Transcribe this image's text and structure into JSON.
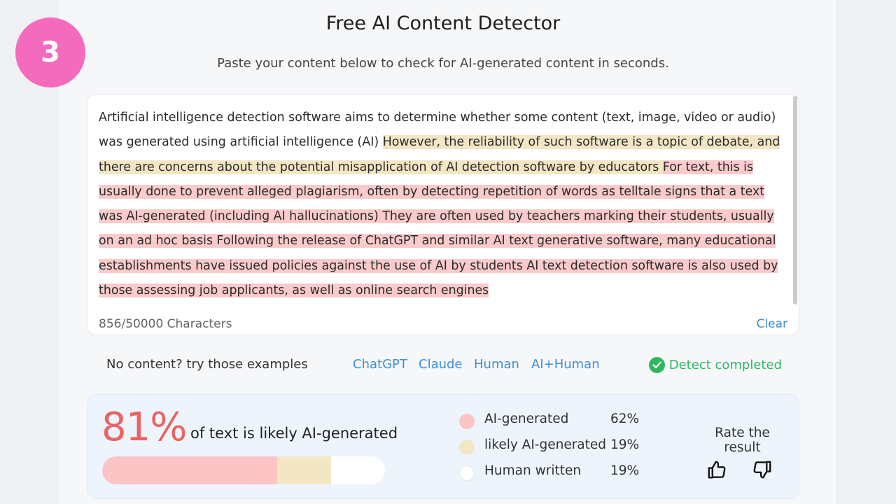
{
  "step_badge": "3",
  "header": {
    "title": "Free AI Content Detector",
    "subtitle": "Paste your content below to check for AI-generated content in seconds."
  },
  "editor": {
    "segments": [
      {
        "type": "human",
        "text": "Artificial intelligence detection software aims to determine whether some content (text, image, video or audio) was generated using artificial intelligence (AI) "
      },
      {
        "type": "likely",
        "text": "However, the reliability of such software is a topic of debate, and there are concerns about the potential misapplication of AI detection software by educators "
      },
      {
        "type": "ai",
        "text": "For text, this is usually done to prevent alleged plagiarism, often by detecting repetition of words as telltale signs that a text was AI-generated (including AI hallucinations) They are often used by teachers marking their students, usually on an ad hoc basis Following the release of ChatGPT and similar AI text generative software, many educational establishments have issued policies against the use of AI by students AI text detection software is also used by those assessing job applicants, as well as online search engines"
      }
    ],
    "char_count": "856/50000 Characters",
    "clear_label": "Clear"
  },
  "examples": {
    "label": "No content? try those examples",
    "links": [
      "ChatGPT",
      "Claude",
      "Human",
      "AI+Human"
    ],
    "status": "Detect completed"
  },
  "result": {
    "score": "81%",
    "caption": "of text is likely AI-generated",
    "bar": {
      "ai_fraction": 0.62,
      "likely_fraction": 0.19,
      "human_fraction": 0.19
    },
    "legend": [
      {
        "label": "AI-generated",
        "pct": "62%",
        "color": "#fcc5c5"
      },
      {
        "label": "likely AI-generated",
        "pct": "19%",
        "color": "#f3e6c4"
      },
      {
        "label": "Human written",
        "pct": "19%",
        "color": "#ffffff"
      }
    ],
    "rate_label": "Rate the result",
    "thumbs_up_icon": "thumbs-up-icon",
    "thumbs_down_icon": "thumbs-down-icon"
  },
  "colors": {
    "accent_link": "#3f8fd6",
    "success": "#2fb760",
    "score": "#e86464",
    "badge": "#f46bbd"
  }
}
